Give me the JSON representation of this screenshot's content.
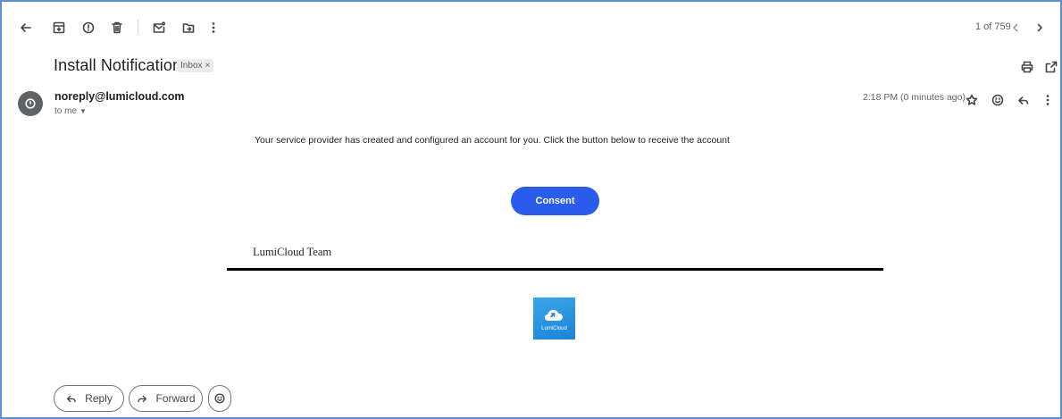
{
  "toolbar": {
    "back_icon": "arrow-left-icon",
    "archive_icon": "archive-icon",
    "report_icon": "report-spam-icon",
    "delete_icon": "trash-icon",
    "mark_unread_icon": "mark-unread-icon",
    "move_icon": "move-to-icon",
    "more_icon": "more-vertical-icon",
    "pager_text": "1 of 759",
    "prev_icon": "chevron-left-icon",
    "next_icon": "chevron-right-icon"
  },
  "email": {
    "subject": "Install Notification",
    "label_chip": "Inbox",
    "label_chip_close": "×",
    "sender": "noreply@lumicloud.com",
    "recipient": "to me",
    "timestamp": "2:18 PM (0 minutes ago)",
    "body_text": "Your service provider has created and configured an account for you. Click the button below to receive the account",
    "cta_label": "Consent",
    "signature": "LumiCloud Team",
    "logo_text": "LumiCloud"
  },
  "actions": {
    "reply_label": "Reply",
    "forward_label": "Forward"
  },
  "colors": {
    "cta": "#2a5bea",
    "frame_border": "#5b8fd6",
    "logo_bg": "#2196e6"
  }
}
